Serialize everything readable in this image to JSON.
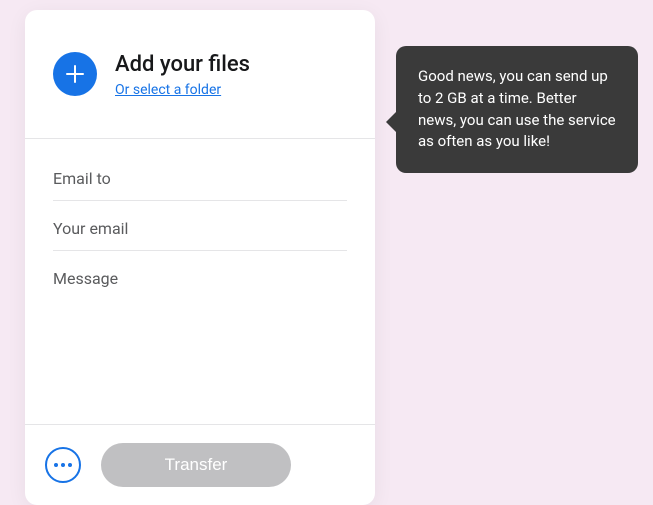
{
  "upload": {
    "title": "Add your files",
    "folder_link": "Or select a folder"
  },
  "fields": {
    "email_to_placeholder": "Email to",
    "your_email_placeholder": "Your email",
    "message_placeholder": "Message"
  },
  "footer": {
    "transfer_label": "Transfer"
  },
  "tooltip": {
    "text": "Good news, you can send up to 2 GB at a time. Better news, you can use the service as often as you like!"
  },
  "colors": {
    "accent": "#1773e6",
    "tooltip_bg": "#3a3a3a",
    "page_bg": "#f6e9f3",
    "disabled": "#c0c0c2"
  }
}
